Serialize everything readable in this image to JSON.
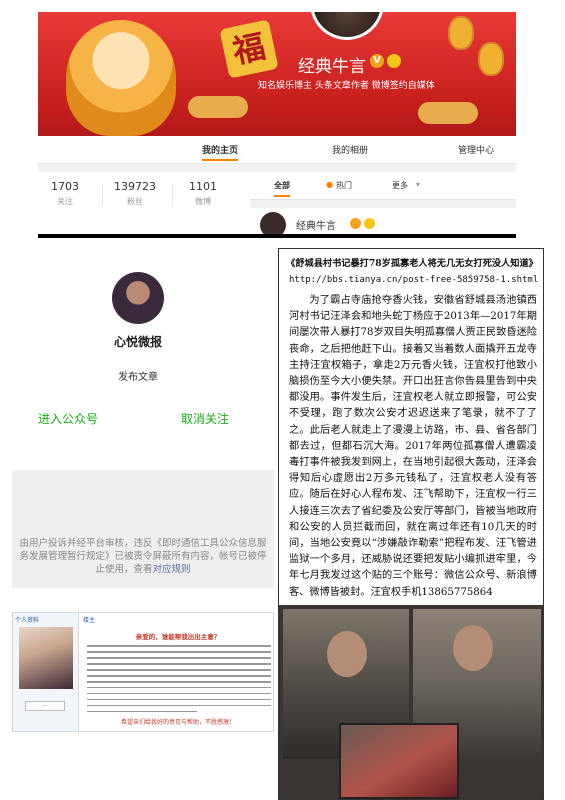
{
  "weibo": {
    "profile_name": "经典牛言",
    "bio": "知名娱乐博主 头条文章作者 微博签约自媒体",
    "nav": [
      "我的主页",
      "我的相册",
      "管理中心"
    ],
    "stats": [
      {
        "value": "1703",
        "label": "关注"
      },
      {
        "value": "139723",
        "label": "粉丝"
      },
      {
        "value": "1101",
        "label": "微博"
      }
    ],
    "feed_tabs": [
      "全部",
      "热门",
      "更多"
    ],
    "post_author": "经典牛言",
    "accent_color": "#ff8200"
  },
  "wechat": {
    "account_name": "心悦微报",
    "send_article": "发布文章",
    "enter_button": "进入公众号",
    "unfollow_button": "取消关注",
    "notice_text": "由用户投诉并经平台审核，违反《即时通信工具公众信息服务发展管理暂行规定》已被责令屏蔽所有内容，帐号已被停止使用，查看",
    "notice_link": "对应规则",
    "accent_color": "#1aad19"
  },
  "forum": {
    "sidebar_header": "个人资料",
    "main_header": "楼主",
    "title": "亲爱的，谁能帮我出出主意？",
    "footer": "希望亲们给我好的意见与帮助，不胜感激！"
  },
  "article": {
    "headline": "《舒城县村书记暴打78岁孤寡老人将无几无女打死没人知道》",
    "url": "http://bbs.tianya.cn/post-free-5859758-1.shtml",
    "body": "为了霸占寺庙抢夺香火钱，安徽省舒城县汤池镇西河村书记汪泽会和地头蛇丁杨应于2013年—2017年期间屡次带人暴打78岁双目失明孤寡僧人贾正民致昏迷险丧命，之后把他赶下山。接着又当着数人面撬开五龙寺主持汪宜权箱子，拿走2万元香火钱，汪宜权打他致小脑损伤至今大小便失禁。开口出狂言你告县里告到中央都没用。事件发生后，汪宜权老人就立即报警，可公安不受理，跑了数次公安才迟迟送来了笔录，就不了了之。此后老人就走上了漫漫上访路，市、县、省各部门都去过，但都石沉大海。2017年两位孤寡僧人遭霸凌毒打事件被我发到网上，在当地引起很大轰动，汪泽会得知后心虚愿出2万多元钱私了，汪宜权老人没有答应。随后在好心人程布发、汪飞帮助下，汪宜权一行三人接连三次去了省纪委及公安厅等部门，皆被当地政府和公安的人员拦截而回，就在离过年还有10几天的时间，当地公安竟以“涉嫌敲诈勒索”把程布发、汪飞管进监狱一个多月，还威胁说还要把发贴小编抓进牢里，今年七月我发过这个贴的三个账号：微信公众号、新浪博客、微博皆被封。汪宜权手机13865775864"
  }
}
